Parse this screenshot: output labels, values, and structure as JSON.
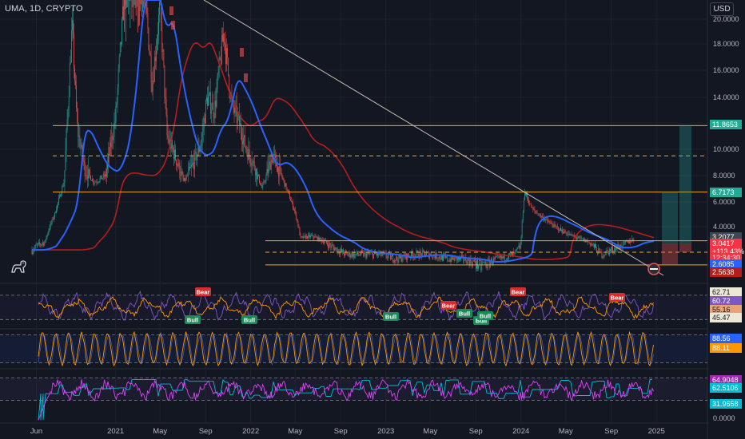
{
  "header": {
    "title": "UMA, 1D, CRYPTO",
    "currency": "USD"
  },
  "colors": {
    "background": "#131722",
    "bull": "#26a69a",
    "bear": "#ef5350",
    "ma_fast": "#2962ff",
    "ma_slow": "#b71c1c",
    "level": "#f5a623",
    "trendline": "#c8c1b4",
    "osc_purple": "#7e57c2",
    "osc_orange": "#ff9800",
    "osc_teal": "#00bcd4",
    "osc_magenta": "#e040fb"
  },
  "chart_data": [
    {
      "type": "line",
      "panel": "price",
      "title": "UMA, 1D, CRYPTO",
      "xlabel": "",
      "ylabel": "",
      "ylim": [
        2.2,
        21.5
      ],
      "y_scale": "log",
      "x_ticks": [
        "Jun",
        "2021",
        "May",
        "Sep",
        "2022",
        "May",
        "Sep",
        "2023",
        "May",
        "Sep",
        "2024",
        "May",
        "Sep",
        "2025"
      ],
      "y_ticks": [
        "20.0000",
        "18.0000",
        "16.0000",
        "14.0000",
        "12.0000",
        "10.0000",
        "8.0000",
        "6.0000",
        "4.0000"
      ],
      "series": [],
      "price_path": {
        "x": [
          "2020-05-20",
          "2020-06-25",
          "2020-07-20",
          "2020-08-15",
          "2020-09-05",
          "2020-09-20",
          "2020-10-10",
          "2020-11-05",
          "2020-12-05",
          "2021-01-01",
          "2021-01-25",
          "2021-02-10",
          "2021-02-25",
          "2021-03-15",
          "2021-04-10",
          "2021-05-01",
          "2021-05-20",
          "2021-06-10",
          "2021-07-05",
          "2021-08-01",
          "2021-08-20",
          "2021-09-05",
          "2021-09-25",
          "2021-10-20",
          "2021-11-10",
          "2021-12-01",
          "2021-12-20",
          "2022-01-10",
          "2022-02-01",
          "2022-03-01",
          "2022-04-01",
          "2022-05-01",
          "2022-05-15",
          "2022-06-15",
          "2022-08-01",
          "2022-09-15",
          "2022-11-01",
          "2022-12-15",
          "2023-02-01",
          "2023-03-15",
          "2023-05-01",
          "2023-06-15",
          "2023-08-01",
          "2023-09-15",
          "2023-11-01",
          "2023-12-15",
          "2024-01-01",
          "2024-01-10",
          "2024-02-01",
          "2024-03-01",
          "2024-04-01",
          "2024-05-01",
          "2024-06-01",
          "2024-07-01",
          "2024-08-05",
          "2024-09-01",
          "2024-10-01",
          "2024-11-01"
        ],
        "close": [
          2.9,
          3.1,
          5.0,
          7.6,
          19.5,
          11.5,
          8.4,
          7.5,
          8.0,
          12.5,
          22.0,
          30.0,
          25.0,
          24.0,
          15.0,
          21.0,
          11.0,
          9.5,
          7.5,
          9.0,
          10.5,
          14.0,
          13.0,
          19.0,
          13.5,
          12.0,
          10.0,
          8.8,
          7.0,
          9.5,
          7.5,
          5.2,
          3.3,
          3.4,
          3.0,
          2.8,
          2.8,
          2.8,
          2.7,
          2.8,
          2.8,
          2.7,
          2.7,
          2.6,
          2.7,
          2.8,
          3.0,
          6.8,
          5.4,
          4.7,
          4.0,
          3.6,
          3.3,
          3.1,
          2.8,
          2.9,
          3.0,
          3.2
        ]
      },
      "markers": [
        {
          "label": "3.2077",
          "value": 3.2077,
          "color": "#434651"
        },
        {
          "label": "3.0417",
          "value": 3.0417,
          "color": "#f23645"
        },
        {
          "label": "+113.43%",
          "value": null,
          "color": "#f23645"
        },
        {
          "label": "12:34:30",
          "value": null,
          "color": "#f23645"
        },
        {
          "label": "2.6085",
          "value": 2.6085,
          "color": "#2962ff"
        },
        {
          "label": "2.5638",
          "value": 2.5638,
          "color": "#b71c1c"
        },
        {
          "label": "11.8653",
          "value": 11.8653,
          "color": "#22ab94"
        },
        {
          "label": "6.7173",
          "value": 6.7173,
          "color": "#22ab94"
        }
      ],
      "levels": [
        11.85,
        9.5,
        6.75,
        3.15,
        2.85,
        2.6
      ],
      "annotations": [
        {
          "text": "Bear",
          "x": "2021-07-15",
          "panel": "osc1"
        },
        {
          "text": "Bull",
          "x": "2021-04-20",
          "panel": "osc1"
        },
        {
          "text": "Bull",
          "x": "2021-09-10",
          "panel": "osc1"
        },
        {
          "text": "Bull",
          "x": "2022-11-20",
          "panel": "osc1"
        },
        {
          "text": "Bear",
          "x": "2023-06-15",
          "panel": "osc1"
        },
        {
          "text": "Bull",
          "x": "2023-08-10",
          "panel": "osc1"
        },
        {
          "text": "Bull",
          "x": "2023-09-10",
          "panel": "osc1"
        },
        {
          "text": "Bull",
          "x": "2023-09-25",
          "panel": "osc1"
        },
        {
          "text": "Bear",
          "x": "2023-12-10",
          "panel": "osc1"
        },
        {
          "text": "Bear",
          "x": "2024-08-10",
          "panel": "osc1"
        }
      ]
    },
    {
      "type": "line",
      "panel": "osc1",
      "ylim": [
        40,
        70
      ],
      "markers": [
        {
          "label": "62.71",
          "value": 62.71,
          "color": "#ede7d6"
        },
        {
          "label": "60.72",
          "value": 60.72,
          "color": "#7e57c2"
        },
        {
          "label": "55.16",
          "value": 55.16,
          "color": "#e9a376"
        },
        {
          "label": "45.47",
          "value": 45.47,
          "color": "#ede7d6"
        }
      ]
    },
    {
      "type": "line",
      "panel": "osc2",
      "ylim": [
        0,
        100
      ],
      "markers": [
        {
          "label": "88.56",
          "value": 88.56,
          "color": "#2962ff"
        },
        {
          "label": "88.11",
          "value": 88.11,
          "color": "#ff9800"
        }
      ]
    },
    {
      "type": "line",
      "panel": "osc3",
      "ylim": [
        0,
        75
      ],
      "y_ticks": [
        "0.0000"
      ],
      "markers": [
        {
          "label": "64.9048",
          "value": 64.9048,
          "color": "#9c27b0"
        },
        {
          "label": "62.5106",
          "value": 62.5106,
          "color": "#00bcd4"
        },
        {
          "label": "31.9658",
          "value": 31.9658,
          "color": "#00bcd4"
        }
      ]
    }
  ]
}
